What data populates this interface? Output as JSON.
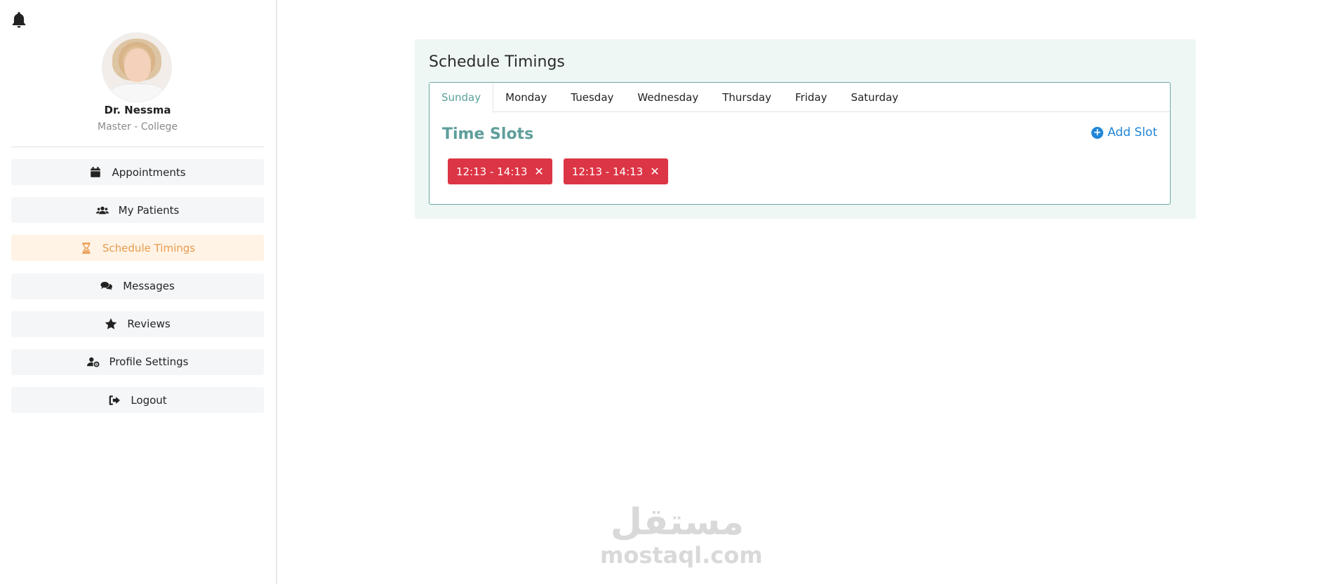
{
  "header": {
    "bell_icon": "bell-icon"
  },
  "profile": {
    "name": "Dr. Nessma",
    "title": "Master - College"
  },
  "sidebar": {
    "items": [
      {
        "label": "Appointments",
        "icon": "calendar-icon",
        "active": false
      },
      {
        "label": "My Patients",
        "icon": "users-icon",
        "active": false
      },
      {
        "label": "Schedule Timings",
        "icon": "hourglass-icon",
        "active": true
      },
      {
        "label": "Messages",
        "icon": "comments-icon",
        "active": false
      },
      {
        "label": "Reviews",
        "icon": "star-icon",
        "active": false
      },
      {
        "label": "Profile Settings",
        "icon": "user-cog-icon",
        "active": false
      },
      {
        "label": "Logout",
        "icon": "sign-out-icon",
        "active": false
      }
    ]
  },
  "main": {
    "title": "Schedule Timings",
    "tabs": [
      {
        "label": "Sunday",
        "active": true
      },
      {
        "label": "Monday",
        "active": false
      },
      {
        "label": "Tuesday",
        "active": false
      },
      {
        "label": "Wednesday",
        "active": false
      },
      {
        "label": "Thursday",
        "active": false
      },
      {
        "label": "Friday",
        "active": false
      },
      {
        "label": "Saturday",
        "active": false
      }
    ],
    "slots_title": "Time Slots",
    "add_slot_label": "Add Slot",
    "slots": [
      {
        "label": "12:13 - 14:13"
      },
      {
        "label": "12:13 - 14:13"
      }
    ]
  },
  "watermark": {
    "logo_text": "مستقل",
    "site": "mostaql.com"
  },
  "colors": {
    "accent": "#5aa09a",
    "active_menu_text": "#e99a4c",
    "active_menu_bg": "#fff3e6",
    "slot_bg": "#dc3545",
    "link": "#1f86d8",
    "card_bg": "#eff7f4"
  }
}
